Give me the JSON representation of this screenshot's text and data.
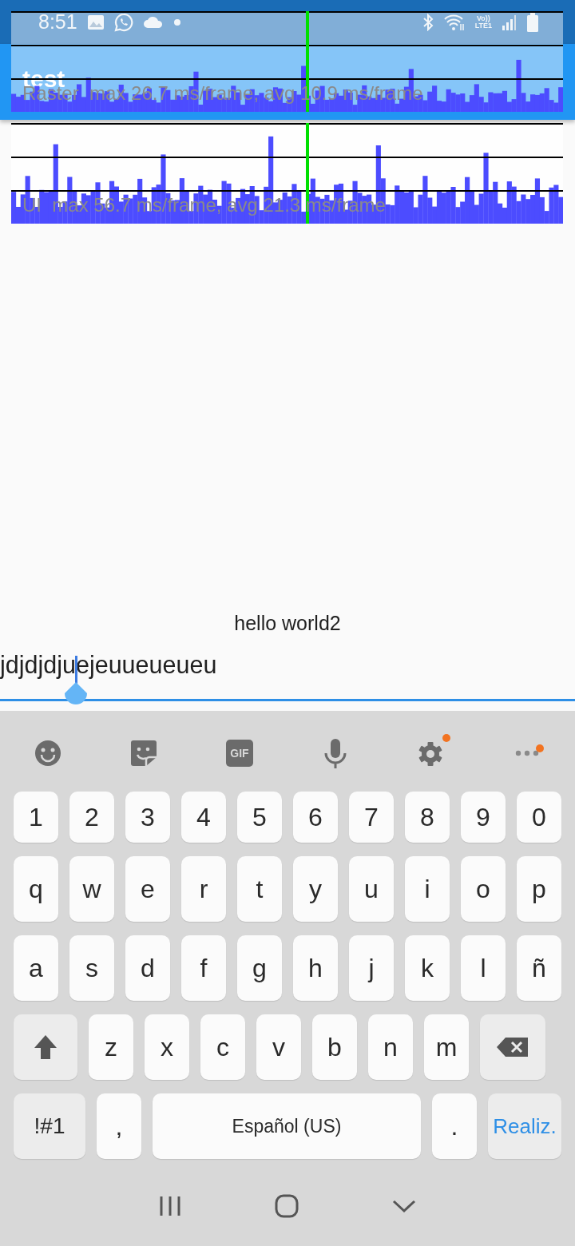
{
  "status_bar": {
    "time": "8:51",
    "volte_label": "Vo))",
    "network_type": "LTE1"
  },
  "app_bar": {
    "title": "test"
  },
  "performance_overlay": {
    "graphs": [
      {
        "kind": "raster",
        "label": "Raster  max 26.7 ms/frame, avg 10.9 ms/frame"
      },
      {
        "kind": "ui",
        "label": "UI  max 56.7 ms/frame, avg 21.3 ms/frame"
      }
    ]
  },
  "body": {
    "text": "hello world2"
  },
  "text_field": {
    "value": "jdjdjdjuejeuueueueu"
  },
  "keyboard": {
    "toolbar": [
      {
        "kind": "emoji",
        "badge": false
      },
      {
        "kind": "sticker",
        "badge": false
      },
      {
        "kind": "gif",
        "label": "GIF",
        "badge": false
      },
      {
        "kind": "voice",
        "badge": false
      },
      {
        "kind": "settings",
        "badge": true
      },
      {
        "kind": "more",
        "badge": true
      }
    ],
    "rows": [
      {
        "keys": [
          {
            "kind": "key",
            "label": "1"
          },
          {
            "kind": "key",
            "label": "2"
          },
          {
            "kind": "key",
            "label": "3"
          },
          {
            "kind": "key",
            "label": "4"
          },
          {
            "kind": "key",
            "label": "5"
          },
          {
            "kind": "key",
            "label": "6"
          },
          {
            "kind": "key",
            "label": "7"
          },
          {
            "kind": "key",
            "label": "8"
          },
          {
            "kind": "key",
            "label": "9"
          },
          {
            "kind": "key",
            "label": "0"
          }
        ]
      },
      {
        "keys": [
          {
            "kind": "key",
            "label": "q"
          },
          {
            "kind": "key",
            "label": "w"
          },
          {
            "kind": "key",
            "label": "e"
          },
          {
            "kind": "key",
            "label": "r"
          },
          {
            "kind": "key",
            "label": "t"
          },
          {
            "kind": "key",
            "label": "y"
          },
          {
            "kind": "key",
            "label": "u"
          },
          {
            "kind": "key",
            "label": "i"
          },
          {
            "kind": "key",
            "label": "o"
          },
          {
            "kind": "key",
            "label": "p"
          }
        ]
      },
      {
        "keys": [
          {
            "kind": "key",
            "label": "a"
          },
          {
            "kind": "key",
            "label": "s"
          },
          {
            "kind": "key",
            "label": "d"
          },
          {
            "kind": "key",
            "label": "f"
          },
          {
            "kind": "key",
            "label": "g"
          },
          {
            "kind": "key",
            "label": "h"
          },
          {
            "kind": "key",
            "label": "j"
          },
          {
            "kind": "key",
            "label": "k"
          },
          {
            "kind": "key",
            "label": "l"
          },
          {
            "kind": "key",
            "label": "ñ"
          }
        ]
      },
      {
        "keys": [
          {
            "kind": "shift"
          },
          {
            "kind": "key",
            "label": "z"
          },
          {
            "kind": "key",
            "label": "x"
          },
          {
            "kind": "key",
            "label": "c"
          },
          {
            "kind": "key",
            "label": "v"
          },
          {
            "kind": "key",
            "label": "b"
          },
          {
            "kind": "key",
            "label": "n"
          },
          {
            "kind": "key",
            "label": "m"
          },
          {
            "kind": "backspace"
          }
        ]
      },
      {
        "keys": [
          {
            "kind": "mode",
            "label": "!#1"
          },
          {
            "kind": "key",
            "label": ","
          },
          {
            "kind": "space",
            "label": "Español (US)"
          },
          {
            "kind": "key",
            "label": "."
          },
          {
            "kind": "action",
            "label": "Realiz."
          }
        ]
      }
    ]
  },
  "nav_bar": {
    "buttons": [
      {
        "kind": "recents"
      },
      {
        "kind": "home"
      },
      {
        "kind": "back"
      }
    ]
  }
}
